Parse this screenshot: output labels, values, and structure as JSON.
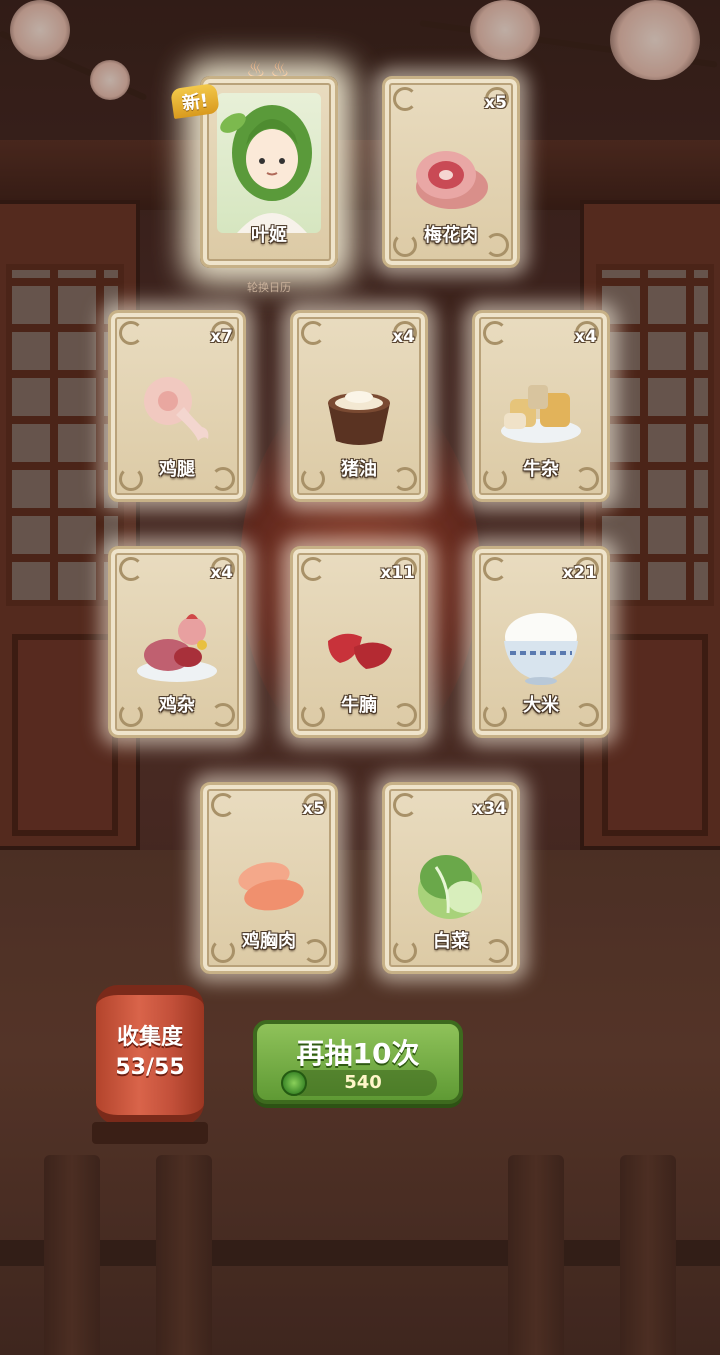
{
  "new_label": "新!",
  "rotation_caption": "轮换日历",
  "cards": [
    {
      "name": "叶姬",
      "count": "",
      "art": "character-portrait",
      "is_new": true
    },
    {
      "name": "梅花肉",
      "count": "x5",
      "art": "pork-icon"
    },
    {
      "name": "鸡腿",
      "count": "x7",
      "art": "chicken-leg-icon"
    },
    {
      "name": "猪油",
      "count": "x4",
      "art": "lard-icon"
    },
    {
      "name": "牛杂",
      "count": "x4",
      "art": "beef-offal-icon"
    },
    {
      "name": "鸡杂",
      "count": "x4",
      "art": "chicken-offal-icon"
    },
    {
      "name": "牛腩",
      "count": "x11",
      "art": "beef-brisket-icon"
    },
    {
      "name": "大米",
      "count": "x21",
      "art": "rice-bowl-icon"
    },
    {
      "name": "鸡胸肉",
      "count": "x5",
      "art": "chicken-breast-icon"
    },
    {
      "name": "白菜",
      "count": "x34",
      "art": "cabbage-icon"
    }
  ],
  "collection": {
    "label": "收集度",
    "progress": "53/55"
  },
  "draw_button": {
    "label": "再抽10次",
    "cost": "540"
  },
  "colors": {
    "button_green": "#6fa83c",
    "lantern_red": "#c3503a",
    "card_bg": "#e4d5b5"
  }
}
